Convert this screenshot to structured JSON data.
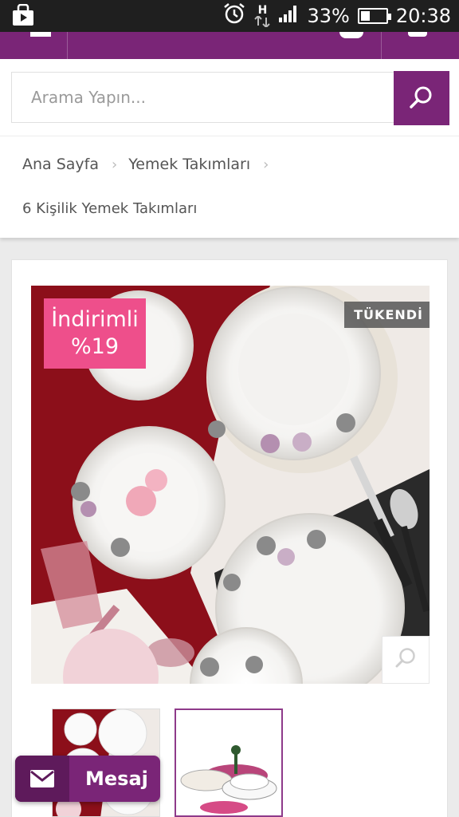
{
  "status_bar": {
    "network": "H",
    "battery": "33%",
    "battery_level": 0.33,
    "time": "20:38",
    "icons": [
      "store-icon",
      "alarm-icon",
      "network-icon",
      "signal-icon",
      "battery-icon"
    ]
  },
  "header": {
    "brand_color": "#7a2577",
    "icons": [
      "menu-icon",
      "user-icon",
      "cart-icon"
    ]
  },
  "search": {
    "placeholder": "Arama Yapın...",
    "icon": "search-icon"
  },
  "breadcrumb": {
    "items": [
      "Ana Sayfa",
      "Yemek Takımları",
      "6 Kişilik Yemek Takımları"
    ]
  },
  "product": {
    "badge_line1": "İndirimli",
    "badge_line2": "%19",
    "stock_label": "TÜKENDİ",
    "badge_color": "#ee4f8b"
  },
  "message_button": {
    "label": "Mesaj",
    "icon": "envelope-icon"
  }
}
